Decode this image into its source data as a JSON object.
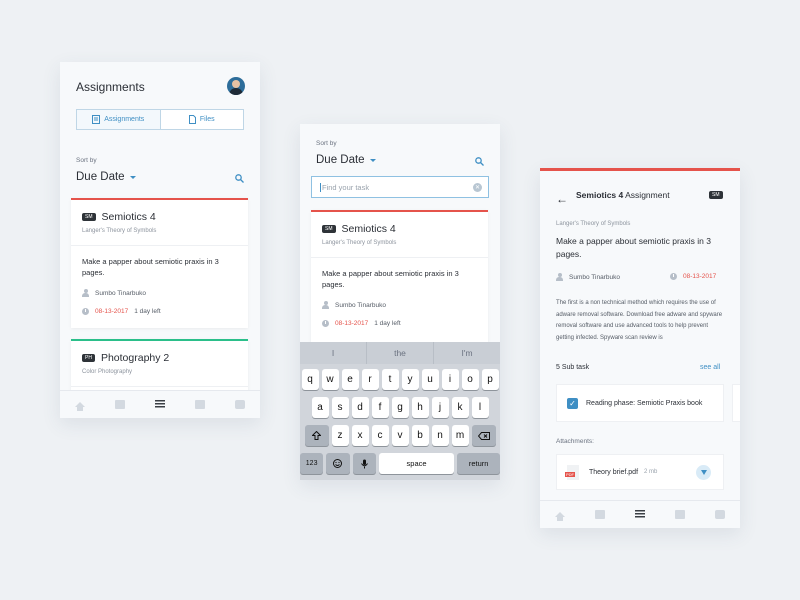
{
  "screen1": {
    "title": "Assignments",
    "tabs": [
      {
        "label": "Assignments",
        "icon": "document-icon"
      },
      {
        "label": "Files",
        "icon": "file-icon"
      }
    ],
    "sort_label": "Sort by",
    "sort_value": "Due Date",
    "cards": [
      {
        "badge": "SM",
        "title": "Semiotics 4",
        "subtitle": "Langer's Theory of Symbols",
        "task": "Make a papper about semiotic praxis in 3 pages.",
        "person": "Sumbo Tinarbuko",
        "date": "08-13-2017",
        "due": "1 day left",
        "accent": "#e5534b"
      },
      {
        "badge": "PH",
        "title": "Photography 2",
        "subtitle": "Color Photography",
        "accent": "#2bbf8a"
      }
    ]
  },
  "screen2": {
    "sort_label": "Sort by",
    "sort_value": "Due Date",
    "search_placeholder": "Find your task",
    "card": {
      "badge": "SM",
      "title": "Semiotics 4",
      "subtitle": "Langer's Theory of Symbols",
      "task": "Make a papper about semiotic praxis in 3 pages.",
      "person": "Sumbo Tinarbuko",
      "date": "08-13-2017",
      "due": "1 day left"
    },
    "keyboard": {
      "suggestions": [
        "I",
        "the",
        "I'm"
      ],
      "row1": [
        "q",
        "w",
        "e",
        "r",
        "t",
        "y",
        "u",
        "i",
        "o",
        "p"
      ],
      "row2": [
        "a",
        "s",
        "d",
        "f",
        "g",
        "h",
        "j",
        "k",
        "l"
      ],
      "row3": [
        "z",
        "x",
        "c",
        "v",
        "b",
        "n",
        "m"
      ],
      "num": "123",
      "space": "space",
      "return": "return"
    }
  },
  "screen3": {
    "header_bold": "Semiotics 4",
    "header_rest": " Assignment",
    "badge": "SM",
    "subtitle": "Langer's Theory of Symbols",
    "task": "Make a papper about semiotic praxis in 3 pages.",
    "person": "Sumbo Tinarbuko",
    "date": "08-13-2017",
    "description": "The first is a non technical method which requires the use of adware removal software. Download free adware and spyware removal software and use advanced tools to help prevent getting infected. Spyware scan review is",
    "subtask_count": "5 Sub task",
    "see_all": "see all",
    "subtask": "Reading phase: Semiotic Praxis book",
    "attachments_label": "Attachments:",
    "attachment_name": "Theory brief.pdf",
    "attachment_size": "2 mb"
  },
  "colors": {
    "accent_red": "#e5534b",
    "accent_green": "#2bbf8a",
    "link_blue": "#3f8fc4"
  }
}
